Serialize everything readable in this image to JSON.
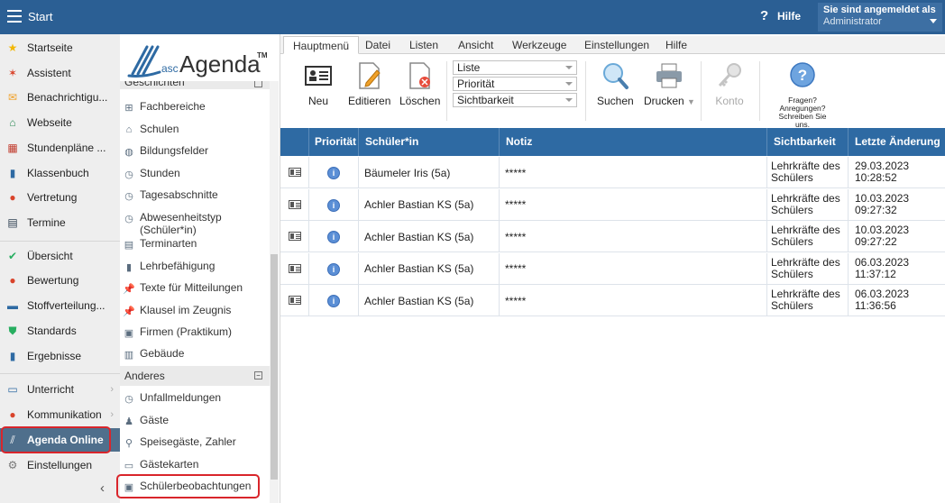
{
  "topbar": {
    "title": "Start",
    "help": "Hilfe",
    "login_line1": "Sie sind angemeldet als",
    "login_line2": "Administrator"
  },
  "nav": {
    "items": [
      {
        "label": "Startseite",
        "icon": "star-icon",
        "color": "#f2b705"
      },
      {
        "label": "Assistent",
        "icon": "wand-icon",
        "color": "#d9442b"
      },
      {
        "label": "Benachrichtigu...",
        "icon": "envelope-icon",
        "color": "#f0a12a"
      },
      {
        "label": "Webseite",
        "icon": "home-icon",
        "color": "#2e8b57"
      },
      {
        "label": "Stundenpläne ...",
        "icon": "timetable-icon",
        "color": "#c0392b"
      },
      {
        "label": "Klassenbuch",
        "icon": "book-icon",
        "color": "#2e6aa3"
      },
      {
        "label": "Vertretung",
        "icon": "substitute-icon",
        "color": "#d9442b"
      },
      {
        "label": "Termine",
        "icon": "calendar-icon",
        "color": "#2c3e50"
      },
      {
        "label": "Übersicht",
        "icon": "check-circle-icon",
        "color": "#27ae60"
      },
      {
        "label": "Bewertung",
        "icon": "rating-icon",
        "color": "#d9442b"
      },
      {
        "label": "Stoffverteilung...",
        "icon": "briefcase-icon",
        "color": "#2e6aa3"
      },
      {
        "label": "Standards",
        "icon": "shield-check-icon",
        "color": "#27ae60"
      },
      {
        "label": "Ergebnisse",
        "icon": "bar-chart-icon",
        "color": "#2e6aa3"
      },
      {
        "label": "Unterricht",
        "icon": "open-book-icon",
        "color": "#2e6aa3"
      },
      {
        "label": "Kommunikation",
        "icon": "people-icon",
        "color": "#d9442b"
      },
      {
        "label": "Agenda Online",
        "icon": "agenda-logo-icon",
        "color": "#ffffff"
      },
      {
        "label": "Einstellungen",
        "icon": "gear-icon",
        "color": "#777777"
      }
    ]
  },
  "logo": {
    "asc": "asc",
    "agenda": "Agenda",
    "tm": "TM"
  },
  "tree": {
    "cut_label": "Geschichten",
    "items": [
      {
        "label": "Fachbereiche",
        "icon": "org-icon"
      },
      {
        "label": "Schulen",
        "icon": "school-icon"
      },
      {
        "label": "Bildungsfelder",
        "icon": "fields-icon"
      },
      {
        "label": "Stunden",
        "icon": "clock-icon"
      },
      {
        "label": "Tagesabschnitte",
        "icon": "clock-icon"
      },
      {
        "label": "Abwesenheitstyp (Schüler*in)",
        "icon": "clock-icon"
      },
      {
        "label": "Terminarten",
        "icon": "calendar-icon"
      },
      {
        "label": "Lehrbefähigung",
        "icon": "teaching-icon"
      },
      {
        "label": "Texte für Mitteilungen",
        "icon": "pin-icon"
      },
      {
        "label": "Klausel im Zeugnis",
        "icon": "pin-icon"
      },
      {
        "label": "Firmen (Praktikum)",
        "icon": "company-icon"
      },
      {
        "label": "Gebäude",
        "icon": "building-icon"
      }
    ],
    "group_label": "Anderes",
    "group_items": [
      {
        "label": "Unfallmeldungen",
        "icon": "clock-icon"
      },
      {
        "label": "Gäste",
        "icon": "guest-icon"
      },
      {
        "label": "Speisegäste, Zahler",
        "icon": "diner-icon"
      },
      {
        "label": "Gästekarten",
        "icon": "guest-card-icon"
      },
      {
        "label": "Schülerbeobachtungen",
        "icon": "student-card-icon"
      }
    ]
  },
  "ribbon": {
    "tabs": [
      "Hauptmenü",
      "Datei",
      "Listen",
      "Ansicht",
      "Werkzeuge",
      "Einstellungen",
      "Hilfe"
    ],
    "neu": "Neu",
    "edit": "Editieren",
    "delete": "Löschen",
    "selects": [
      "Liste",
      "Priorität",
      "Sichtbarkeit"
    ],
    "search": "Suchen",
    "print": "Drucken",
    "konto": "Konto",
    "fragen": [
      "Fragen?",
      "Anregungen?",
      "Schreiben Sie uns."
    ]
  },
  "table": {
    "headers": [
      "Priorität",
      "Schüler*in",
      "Notiz",
      "Sichtbarkeit",
      "Letzte Änderung ▼"
    ],
    "rows": [
      {
        "student": "Bäumeler Iris (5a)",
        "note": "*****",
        "vis1": "Lehrkräfte des",
        "vis2": "Schülers",
        "date": "29.03.2023",
        "time": "10:28:52"
      },
      {
        "student": "Achler Bastian KS (5a)",
        "note": "*****",
        "vis1": "Lehrkräfte des",
        "vis2": "Schülers",
        "date": "10.03.2023",
        "time": "09:27:32"
      },
      {
        "student": "Achler Bastian KS (5a)",
        "note": "*****",
        "vis1": "Lehrkräfte des",
        "vis2": "Schülers",
        "date": "10.03.2023",
        "time": "09:27:22"
      },
      {
        "student": "Achler Bastian KS (5a)",
        "note": "*****",
        "vis1": "Lehrkräfte des",
        "vis2": "Schülers",
        "date": "06.03.2023",
        "time": "11:37:12"
      },
      {
        "student": "Achler Bastian KS (5a)",
        "note": "*****",
        "vis1": "Lehrkräfte des",
        "vis2": "Schülers",
        "date": "06.03.2023",
        "time": "11:36:56"
      }
    ]
  }
}
